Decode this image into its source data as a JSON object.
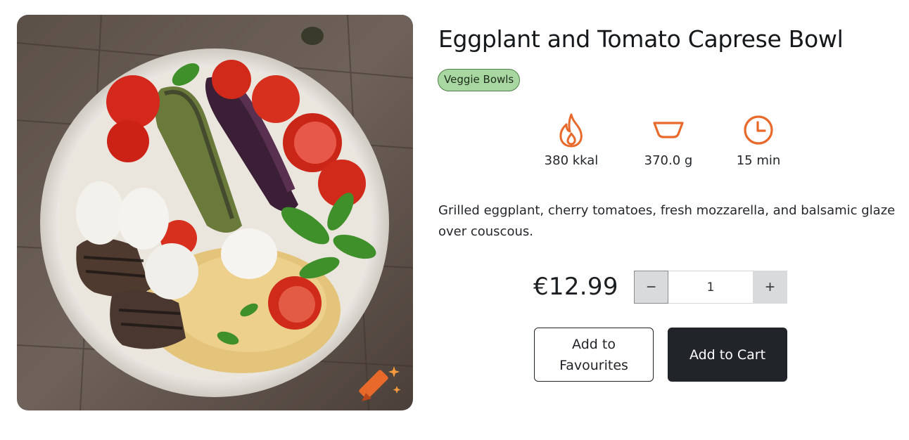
{
  "product": {
    "title": "Eggplant and Tomato Caprese Bowl",
    "category": "Veggie Bowls",
    "image_alt": "Eggplant and Tomato Caprese Bowl",
    "description": "Grilled eggplant, cherry tomatoes, fresh mozzarella, and balsamic glaze over couscous.",
    "price": "€12.99"
  },
  "stats": [
    {
      "icon": "flame-icon",
      "value": "380 kkal"
    },
    {
      "icon": "bowl-icon",
      "value": "370.0 g"
    },
    {
      "icon": "clock-icon",
      "value": "15 min"
    }
  ],
  "quantity": {
    "value": "1",
    "minus_label": "−",
    "plus_label": "+"
  },
  "actions": {
    "favourites_label": "Add to Favourites",
    "cart_label": "Add to Cart"
  },
  "colors": {
    "accent_orange": "#e8692a",
    "badge_bg": "#a9d7a1",
    "badge_border": "#4f7f48",
    "dark_button": "#212529"
  },
  "image_badge": {
    "icon": "crayon-sparkle-icon"
  }
}
